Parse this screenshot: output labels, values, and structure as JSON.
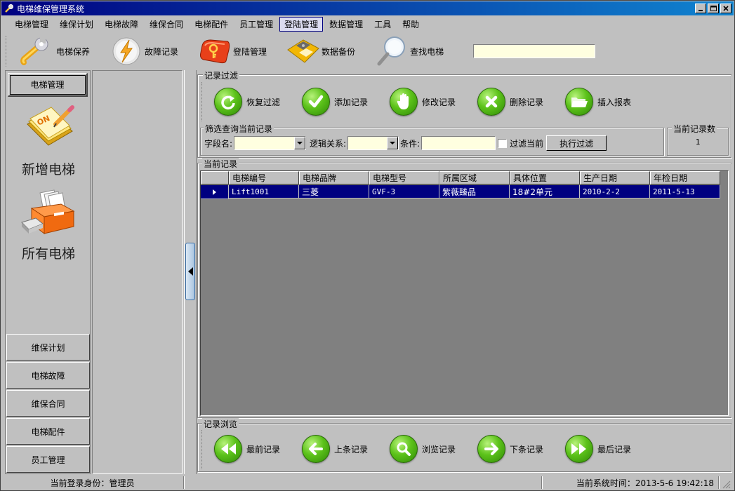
{
  "window": {
    "title": "电梯维保管理系统"
  },
  "menubar": {
    "items": [
      "电梯管理",
      "维保计划",
      "电梯故障",
      "维保合同",
      "电梯配件",
      "员工管理",
      "登陆管理",
      "数据管理",
      "工具",
      "帮助"
    ],
    "active_index": 6
  },
  "toolbar": {
    "buttons": [
      {
        "label": "电梯保养",
        "icon": "wrench-icon"
      },
      {
        "label": "故障记录",
        "icon": "lightning-icon"
      },
      {
        "label": "登陆管理",
        "icon": "key-icon"
      },
      {
        "label": "数据备份",
        "icon": "floppy-disk-icon"
      },
      {
        "label": "查找电梯",
        "icon": "magnifier-icon"
      }
    ],
    "search_value": ""
  },
  "leftnav": {
    "top_button": "电梯管理",
    "big_items": [
      {
        "label": "新增电梯",
        "icon": "notepad-pencil-icon"
      },
      {
        "label": "所有电梯",
        "icon": "filing-drawer-icon"
      }
    ],
    "sections": [
      "维保计划",
      "电梯故障",
      "维保合同",
      "电梯配件",
      "员工管理"
    ]
  },
  "filter_group": {
    "title": "记录过滤",
    "actions": [
      {
        "label": "恢复过滤",
        "icon": "refresh-icon"
      },
      {
        "label": "添加记录",
        "icon": "checkmark-icon"
      },
      {
        "label": "修改记录",
        "icon": "hand-icon"
      },
      {
        "label": "删除记录",
        "icon": "x-icon"
      },
      {
        "label": "插入报表",
        "icon": "folder-icon"
      }
    ],
    "query_title": "筛选查询当前记录",
    "field_label": "字段名:",
    "field_value": "",
    "logic_label": "逻辑关系:",
    "logic_value": "",
    "condition_label": "条件:",
    "condition_value": "",
    "filter_current_label": "过滤当前",
    "filter_current_checked": false,
    "execute_label": "执行过滤",
    "count_title": "当前记录数",
    "count_value": "1"
  },
  "records": {
    "title": "当前记录",
    "columns": [
      "电梯编号",
      "电梯品牌",
      "电梯型号",
      "所属区域",
      "具体位置",
      "生产日期",
      "年检日期"
    ],
    "rows": [
      [
        "Lift1001",
        "三菱",
        "GVF-3",
        "紫薇臻品",
        "18#2单元",
        "2010-2-2",
        "2011-5-13"
      ]
    ],
    "selected_row": 0
  },
  "browse_group": {
    "title": "记录浏览",
    "actions": [
      {
        "label": "最前记录",
        "icon": "double-left-arrow-icon"
      },
      {
        "label": "上条记录",
        "icon": "left-arrow-icon"
      },
      {
        "label": "浏览记录",
        "icon": "magnifier-icon"
      },
      {
        "label": "下条记录",
        "icon": "right-arrow-icon"
      },
      {
        "label": "最后记录",
        "icon": "double-right-arrow-icon"
      }
    ]
  },
  "statusbar": {
    "login_identity": "当前登录身份：管理员",
    "middle": "",
    "system_time": "当前系统时间：2013-5-6 19:42:18"
  },
  "colors": {
    "titlebar": "#000080",
    "face": "#c0c0c0",
    "selection": "#000080",
    "input_bg": "#ffffe0",
    "action_green": "#5cc21a"
  }
}
